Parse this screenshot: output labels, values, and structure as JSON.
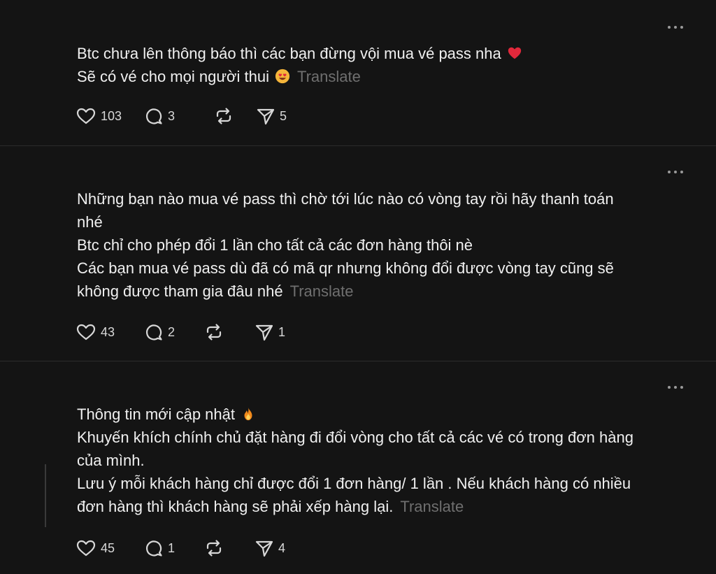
{
  "posts": [
    {
      "lines": [
        "Btc chưa lên thông báo thì các bạn đừng vội mua vé pass nha",
        "Sẽ có vé cho mọi người thui"
      ],
      "translate_label": "Translate",
      "likes": "103",
      "replies": "3",
      "shares": "5"
    },
    {
      "lines": [
        "Những bạn nào mua vé pass thì chờ tới lúc nào có vòng tay rồi hãy thanh toán",
        "nhé",
        "Btc chỉ cho phép đổi 1 lần cho tất cả các đơn hàng thôi nè",
        "Các bạn mua vé pass dù đã có mã qr nhưng không đổi được vòng tay cũng sẽ",
        "không được tham gia đâu nhé"
      ],
      "translate_label": "Translate",
      "likes": "43",
      "replies": "2",
      "shares": "1"
    },
    {
      "lines": [
        "Thông tin mới cập nhật",
        "Khuyến khích chính chủ đặt hàng đi đổi vòng cho tất cả các vé có trong đơn hàng",
        "của mình.",
        "Lưu ý mỗi khách hàng chỉ được đổi 1 đơn hàng/ 1 lần . Nếu khách hàng có nhiều",
        "đơn hàng thì khách hàng sẽ phải xếp hàng lại."
      ],
      "translate_label": "Translate",
      "likes": "45",
      "replies": "1",
      "shares": "4"
    }
  ],
  "icons": {
    "more": "more-icon",
    "like": "heart-icon",
    "reply": "comment-icon",
    "repost": "repost-icon",
    "share": "send-icon",
    "emoji_1": "red-heart-emoji",
    "emoji_2": "heart-eyes-emoji",
    "emoji_3": "fire-emoji"
  },
  "colors": {
    "background": "#141414",
    "text": "#f0f0f0",
    "muted": "#6f6f6f",
    "icon": "#d8d8d8"
  }
}
